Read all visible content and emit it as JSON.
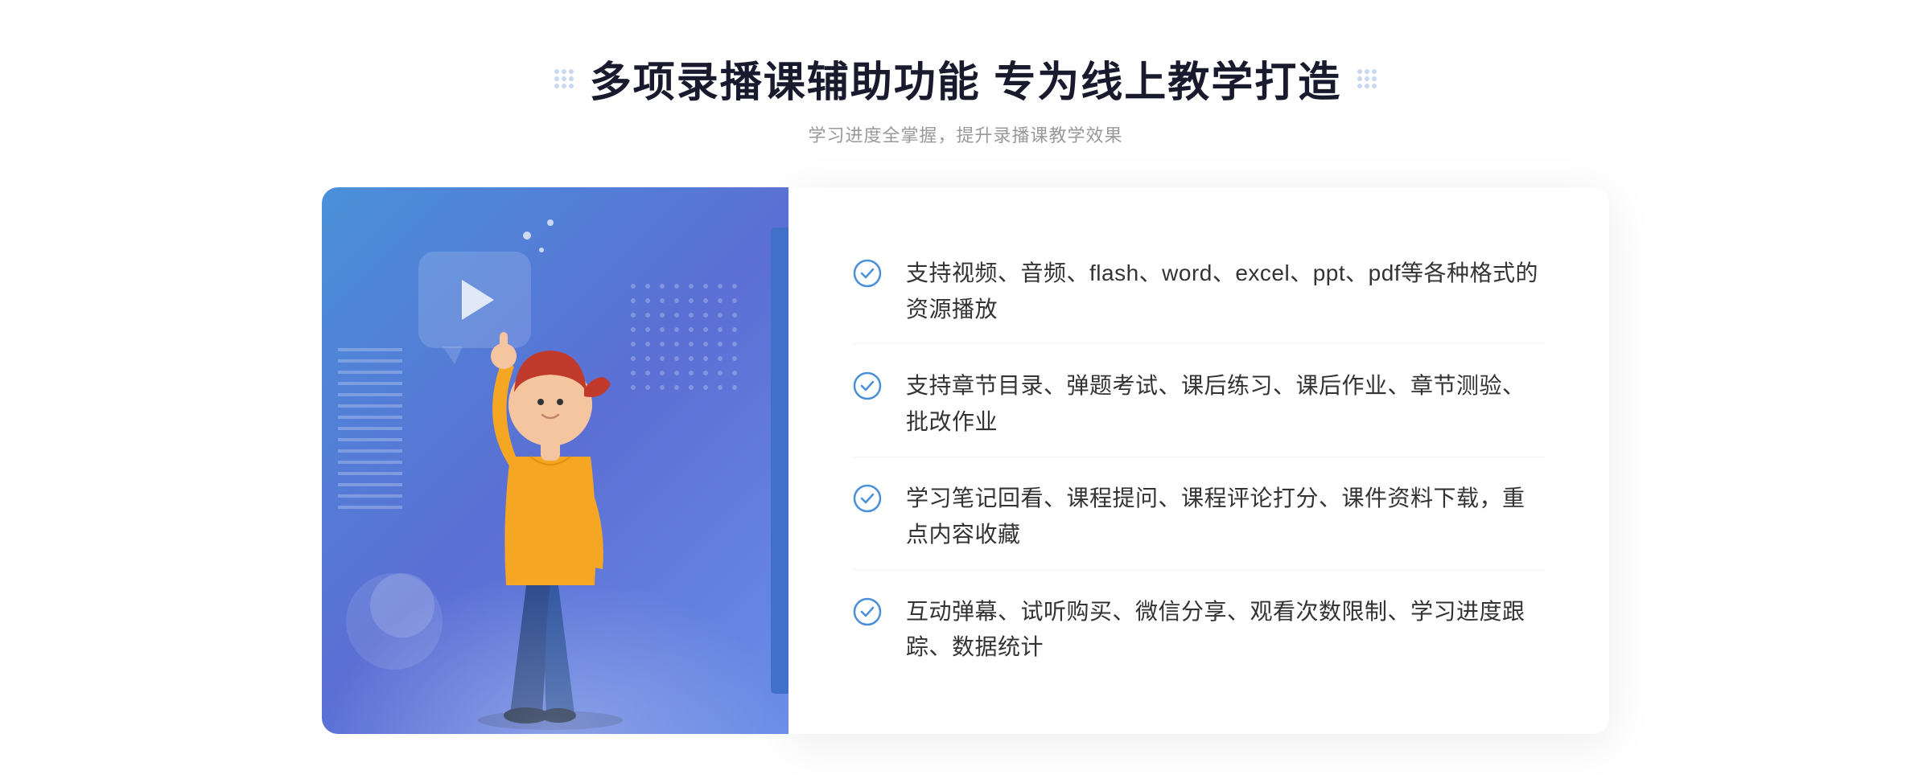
{
  "page": {
    "title": "多项录播课辅助功能 专为线上教学打造",
    "subtitle": "学习进度全掌握，提升录播课教学效果",
    "accent_color": "#3a7bd5",
    "features": [
      {
        "id": 1,
        "text": "支持视频、音频、flash、word、excel、ppt、pdf等各种格式的资源播放"
      },
      {
        "id": 2,
        "text": "支持章节目录、弹题考试、课后练习、课后作业、章节测验、批改作业"
      },
      {
        "id": 3,
        "text": "学习笔记回看、课程提问、课程评论打分、课件资料下载，重点内容收藏"
      },
      {
        "id": 4,
        "text": "互动弹幕、试听购买、微信分享、观看次数限制、学习进度跟踪、数据统计"
      }
    ]
  }
}
